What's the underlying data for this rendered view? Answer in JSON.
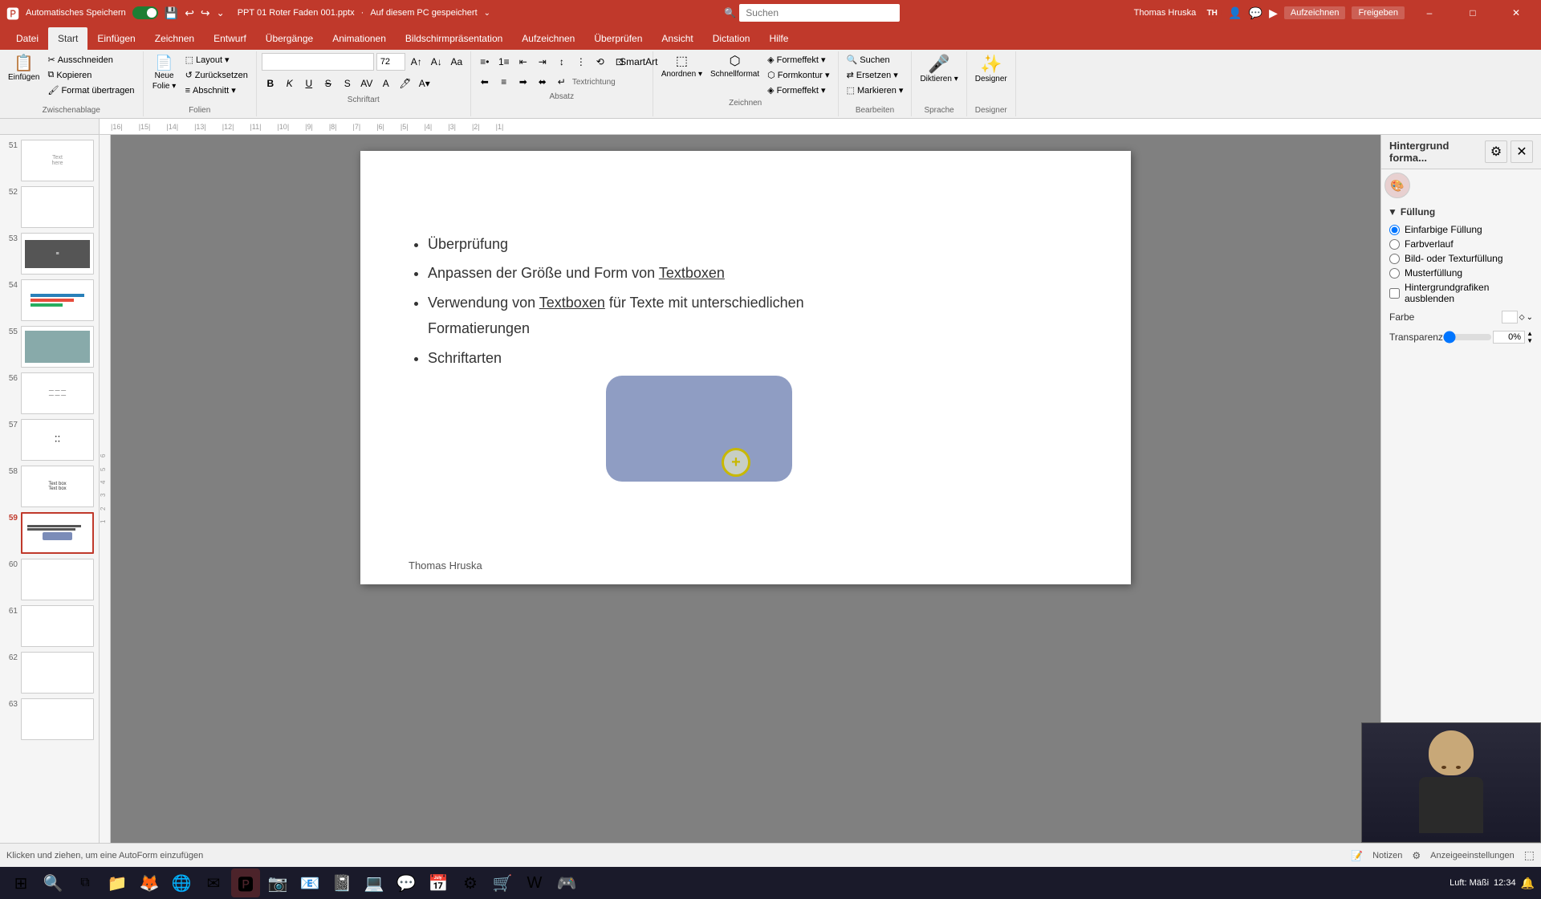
{
  "titlebar": {
    "autosave_label": "Automatisches Speichern",
    "filename": "PPT 01 Roter Faden 001.pptx",
    "save_location": "Auf diesem PC gespeichert",
    "user_name": "Thomas Hruska",
    "search_placeholder": "Suchen",
    "minimize_label": "–",
    "maximize_label": "□",
    "close_label": "✕"
  },
  "ribbon_tabs": [
    {
      "id": "datei",
      "label": "Datei"
    },
    {
      "id": "start",
      "label": "Start",
      "active": true
    },
    {
      "id": "einfuegen",
      "label": "Einfügen"
    },
    {
      "id": "zeichnen",
      "label": "Zeichnen"
    },
    {
      "id": "entwurf",
      "label": "Entwurf"
    },
    {
      "id": "uebergaenge",
      "label": "Übergänge"
    },
    {
      "id": "animationen",
      "label": "Animationen"
    },
    {
      "id": "bildschirm",
      "label": "Bildschirmpräsentation"
    },
    {
      "id": "aufzeichnen",
      "label": "Aufzeichnen"
    },
    {
      "id": "ueberpruefen",
      "label": "Überprüfen"
    },
    {
      "id": "ansicht",
      "label": "Ansicht"
    },
    {
      "id": "dictation",
      "label": "Dictation"
    },
    {
      "id": "hilfe",
      "label": "Hilfe"
    }
  ],
  "ribbon_groups": {
    "zwischenablage": "Zwischenablage",
    "folien": "Folien",
    "schriftart": "Schriftart",
    "absatz": "Absatz",
    "zeichnen_group": "Zeichnen",
    "bearbeiten": "Bearbeiten",
    "sprache": "Sprache",
    "designer": "Designer"
  },
  "ribbon_buttons": {
    "einfuegen": "Einfügen",
    "neue_folie": "Neue\nFolie",
    "layout": "Layout",
    "zuruecksetzen": "Zurücksetzen",
    "abschnitt": "Abschnitt",
    "ausschneiden": "Ausschneiden",
    "kopieren": "Kopieren",
    "format_uebertragen": "Format übertragen",
    "suchen": "Suchen",
    "ersetzen": "Ersetzen",
    "markieren": "Markieren",
    "diktieren": "Diktieren",
    "designer": "Designer",
    "aufzeichnen": "Aufzeichnen",
    "freigeben": "Freigeben",
    "anordnen": "Anordnen",
    "schnellformatvorlagen": "Schnellformat-\nvorlagen",
    "formeffekt": "Formeffekt",
    "formkontur": "Formkontur",
    "formeffekt2": "Formeffekt"
  },
  "font": {
    "name": "",
    "size": "72"
  },
  "slide_numbers": [
    51,
    52,
    53,
    54,
    55,
    56,
    57,
    58,
    59,
    60,
    61,
    62,
    63
  ],
  "current_slide": 59,
  "slide_content": {
    "bullets": [
      "Überprüfung",
      "Anpassen der Größe und Form von Textboxen",
      "Verwendung von Textboxen für Texte mit unterschiedlichen\nFormatierungen",
      "Schriftarten"
    ],
    "footer": "Thomas Hruska"
  },
  "right_panel": {
    "title": "Hintergrund forma...",
    "sections": {
      "fuellung": {
        "label": "Füllung",
        "options": [
          {
            "id": "einfarbig",
            "label": "Einfarbige Füllung",
            "selected": true
          },
          {
            "id": "farbverlauf",
            "label": "Farbverlauf",
            "selected": false
          },
          {
            "id": "bild_textur",
            "label": "Bild- oder Texturfüllung",
            "selected": false
          },
          {
            "id": "muster",
            "label": "Musterfüllung",
            "selected": false
          }
        ],
        "checkbox": "Hintergrundgrafiken ausblenden"
      }
    },
    "farbe_label": "Farbe",
    "transparenz_label": "Transparenz",
    "transparenz_value": "0%"
  },
  "statusbar": {
    "left": "Klicken und ziehen, um eine AutoForm einzufügen",
    "notizen": "Notizen",
    "anzeigeeinstellungen": "Anzeigeeinstellungen"
  },
  "taskbar": {
    "time": "Luft: Mäßi",
    "icons": [
      "⊞",
      "📁",
      "🦊",
      "🌐",
      "✉",
      "📊",
      "🎵",
      "📱",
      "🔔",
      "📋",
      "📓",
      "📝",
      "💬",
      "🗂",
      "🔧",
      "💻",
      "🎮"
    ]
  }
}
